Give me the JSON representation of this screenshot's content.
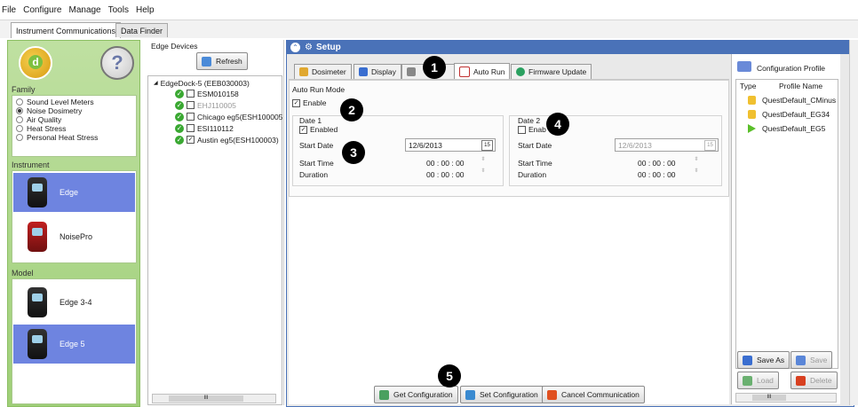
{
  "menu": [
    "File",
    "Configure",
    "Manage",
    "Tools",
    "Help"
  ],
  "main_tabs": [
    "Instrument Communications",
    "Data Finder"
  ],
  "family": {
    "title": "Family",
    "options": [
      "Sound Level Meters",
      "Noise Dosimetry",
      "Air Quality",
      "Heat Stress",
      "Personal Heat Stress"
    ],
    "selected": "Noise Dosimetry"
  },
  "instrument": {
    "title": "Instrument",
    "items": [
      "Edge",
      "NoisePro"
    ],
    "selected": "Edge"
  },
  "model": {
    "title": "Model",
    "items": [
      "Edge 3-4",
      "Edge 5"
    ],
    "selected": "Edge 5"
  },
  "edge_devices": {
    "title": "Edge Devices",
    "refresh_label": "Refresh",
    "dock_label": "EdgeDock-5 (EEB030003)",
    "devices": [
      {
        "label": "ESM010158",
        "checked": false
      },
      {
        "label": "EHJ110005",
        "checked": false
      },
      {
        "label": "Chicago eg5(ESH100005",
        "checked": false
      },
      {
        "label": "ESI110112",
        "checked": false
      },
      {
        "label": "Austin eg5(ESH100003)",
        "checked": true
      }
    ]
  },
  "setup": {
    "title": "Setup",
    "tabs": [
      "Dosimeter",
      "Display",
      "Auto Run",
      "Firmware Update"
    ],
    "active_tab": "Auto Run",
    "auto_run": {
      "mode_label": "Auto Run Mode",
      "enable_label": "Enable",
      "date1": {
        "title": "Date 1",
        "enabled_label": "Enabled",
        "start_date_label": "Start Date",
        "start_date_value": "12/6/2013",
        "start_time_label": "Start Time",
        "start_time_value": "00 : 00 : 00",
        "duration_label": "Duration",
        "duration_value": "00 : 00 : 00"
      },
      "date2": {
        "title": "Date 2",
        "enabled_label": "Enab",
        "start_date_label": "Start Date",
        "start_date_value": "12/6/2013",
        "start_time_label": "Start Time",
        "start_time_value": "00 : 00 : 00",
        "duration_label": "Duration",
        "duration_value": "00 : 00 : 00"
      }
    },
    "buttons": {
      "get": "Get Configuration",
      "set": "Set Configuration",
      "cancel": "Cancel Communication"
    }
  },
  "profiles": {
    "title": "Configuration Profile",
    "col_type": "Type",
    "col_name": "Profile Name",
    "items": [
      {
        "name": "QuestDefault_CMinus",
        "type": "lock"
      },
      {
        "name": "QuestDefault_EG34",
        "type": "lock"
      },
      {
        "name": "QuestDefault_EG5",
        "type": "arrow"
      }
    ],
    "save_as": "Save As",
    "save": "Save",
    "load": "Load",
    "delete": "Delete"
  },
  "callouts": [
    "1",
    "2",
    "3",
    "4",
    "5"
  ],
  "scroll_glyph": "III",
  "spinner_glyph": "⇳"
}
